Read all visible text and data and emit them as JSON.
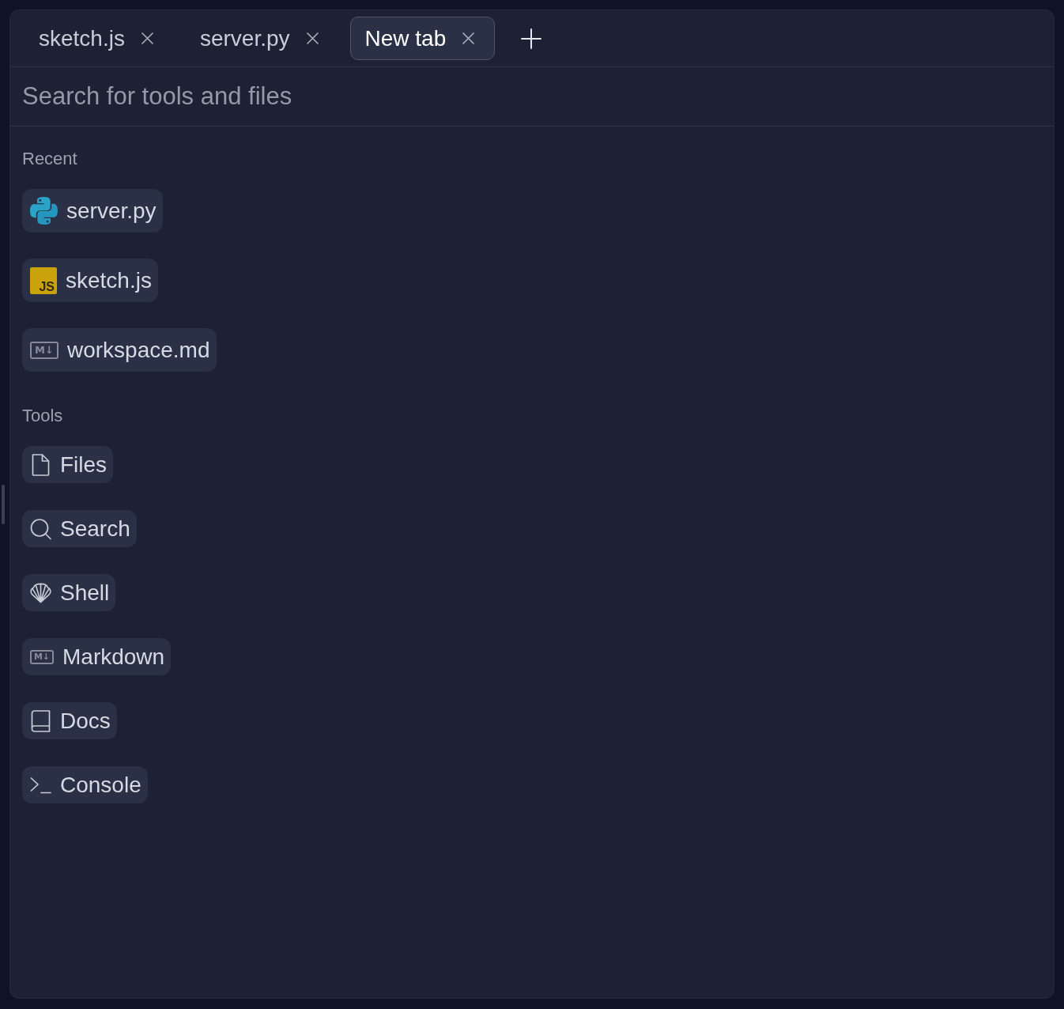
{
  "tabs": [
    {
      "label": "sketch.js",
      "selected": false
    },
    {
      "label": "server.py",
      "selected": false
    },
    {
      "label": "New tab",
      "selected": true
    }
  ],
  "search": {
    "placeholder": "Search for tools and files"
  },
  "sections": [
    {
      "title": "Recent",
      "kind": "recent",
      "items": [
        {
          "label": "server.py",
          "kind": "python"
        },
        {
          "label": "sketch.js",
          "kind": "javascript",
          "icon_text": "JS"
        },
        {
          "label": "workspace.md",
          "kind": "markdown",
          "icon_text": "M↓"
        }
      ]
    },
    {
      "title": "Tools",
      "kind": "tools",
      "items": [
        {
          "label": "Files",
          "kind": "file"
        },
        {
          "label": "Search",
          "kind": "search"
        },
        {
          "label": "Shell",
          "kind": "shell"
        },
        {
          "label": "Markdown",
          "kind": "markdown",
          "icon_text": "M↓"
        },
        {
          "label": "Docs",
          "kind": "book"
        },
        {
          "label": "Console",
          "kind": "terminal"
        }
      ]
    }
  ]
}
